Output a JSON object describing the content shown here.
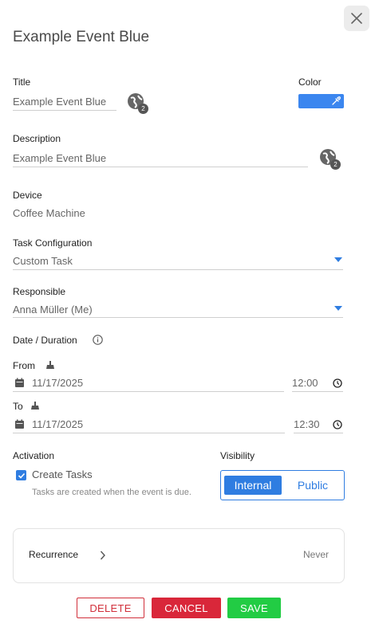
{
  "dialog": {
    "title": "Example Event Blue",
    "close_icon": "close-icon"
  },
  "title_field": {
    "label": "Title",
    "value": "Example Event Blue",
    "translations_count": "2"
  },
  "color_field": {
    "label": "Color",
    "value": "#3b86ef"
  },
  "description_field": {
    "label": "Description",
    "value": "Example Event Blue",
    "translations_count": "2"
  },
  "device": {
    "label": "Device",
    "value": "Coffee Machine"
  },
  "task_configuration": {
    "label": "Task Configuration",
    "value": "Custom Task"
  },
  "responsible": {
    "label": "Responsible",
    "value": "Anna Müller (Me)"
  },
  "date_duration": {
    "label": "Date / Duration"
  },
  "from": {
    "label": "From",
    "date": "11/17/2025",
    "time": "12:00"
  },
  "to": {
    "label": "To",
    "date": "11/17/2025",
    "time": "12:30"
  },
  "activation": {
    "label": "Activation",
    "checkbox_label": "Create Tasks",
    "checked": true,
    "hint": "Tasks are created when the event is due."
  },
  "visibility": {
    "label": "Visibility",
    "options": [
      "Internal",
      "Public"
    ],
    "selected": "Internal"
  },
  "recurrence": {
    "label": "Recurrence",
    "value": "Never"
  },
  "actions": {
    "delete": "DELETE",
    "cancel": "CANCEL",
    "save": "SAVE"
  },
  "colors": {
    "accent": "#2f7de1",
    "danger": "#d9273a",
    "success": "#22cc44"
  }
}
